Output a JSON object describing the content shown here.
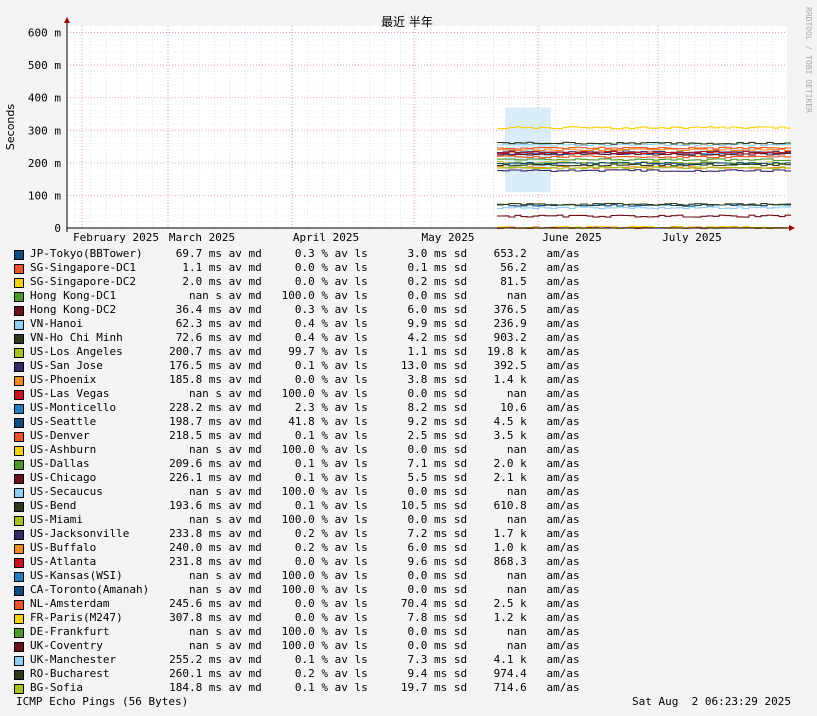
{
  "chart_data": {
    "type": "line",
    "title": "最近 半年",
    "ylabel": "Seconds",
    "vertical_label": "RRDTOOL / TOBI OETIKER",
    "ylim": [
      0,
      0.62
    ],
    "y_ticks": [
      "0",
      "100 m",
      "200 m",
      "300 m",
      "400 m",
      "500 m",
      "600 m"
    ],
    "x_ticks": [
      "February 2025",
      "March 2025",
      "April 2025",
      "May 2025",
      "June 2025",
      "July 2025"
    ],
    "grid": true,
    "data_start_label": "May 2025",
    "series": [
      {
        "name": "JP-Tokyo(BBTower)",
        "color": "#0b4d7d",
        "value": "69.7 ms av md",
        "loss": "0.3 % av ls",
        "sd": "3.0 ms sd",
        "ratio": "653.2",
        "unit": "am/as"
      },
      {
        "name": "SG-Singapore-DC1",
        "color": "#ee5522",
        "value": "1.1 ms av md",
        "loss": "0.0 % av ls",
        "sd": "0.1 ms sd",
        "ratio": "56.2",
        "unit": "am/as"
      },
      {
        "name": "SG-Singapore-DC2",
        "color": "#f7d200",
        "value": "2.0 ms av md",
        "loss": "0.0 % av ls",
        "sd": "0.2 ms sd",
        "ratio": "81.5",
        "unit": "am/as"
      },
      {
        "name": "Hong Kong-DC1",
        "color": "#4c9a2a",
        "value": "nan s av md",
        "loss": "100.0 % av ls",
        "sd": "0.0 ms sd",
        "ratio": "nan",
        "unit": "am/as"
      },
      {
        "name": "Hong Kong-DC2",
        "color": "#6b0f1a",
        "value": "36.4 ms av md",
        "loss": "0.3 % av ls",
        "sd": "6.0 ms sd",
        "ratio": "376.5",
        "unit": "am/as"
      },
      {
        "name": "VN-Hanoi",
        "color": "#8ecdf5",
        "value": "62.3 ms av md",
        "loss": "0.4 % av ls",
        "sd": "9.9 ms sd",
        "ratio": "236.9",
        "unit": "am/as"
      },
      {
        "name": "VN-Ho Chi Minh",
        "color": "#2d3b16",
        "value": "72.6 ms av md",
        "loss": "0.4 % av ls",
        "sd": "4.2 ms sd",
        "ratio": "903.2",
        "unit": "am/as"
      },
      {
        "name": "US-Los Angeles",
        "color": "#a6c21c",
        "value": "200.7 ms av md",
        "loss": "99.7 % av ls",
        "sd": "1.1 ms sd",
        "ratio": "19.8 k",
        "unit": "am/as"
      },
      {
        "name": "US-San Jose",
        "color": "#3b2a6b",
        "value": "176.5 ms av md",
        "loss": "0.1 % av ls",
        "sd": "13.0 ms sd",
        "ratio": "392.5",
        "unit": "am/as"
      },
      {
        "name": "US-Phoenix",
        "color": "#f08a1c",
        "value": "185.8 ms av md",
        "loss": "0.0 % av ls",
        "sd": "3.8 ms sd",
        "ratio": "1.4 k",
        "unit": "am/as"
      },
      {
        "name": "US-Las Vegas",
        "color": "#c8101e",
        "value": "nan s av md",
        "loss": "100.0 % av ls",
        "sd": "0.0 ms sd",
        "ratio": "nan",
        "unit": "am/as"
      },
      {
        "name": "US-Monticello",
        "color": "#1e7fc0",
        "value": "228.2 ms av md",
        "loss": "2.3 % av ls",
        "sd": "8.2 ms sd",
        "ratio": "10.6",
        "unit": "am/as"
      },
      {
        "name": "US-Seattle",
        "color": "#0b4d7d",
        "value": "198.7 ms av md",
        "loss": "41.8 % av ls",
        "sd": "9.2 ms sd",
        "ratio": "4.5 k",
        "unit": "am/as"
      },
      {
        "name": "US-Denver",
        "color": "#ee5522",
        "value": "218.5 ms av md",
        "loss": "0.1 % av ls",
        "sd": "2.5 ms sd",
        "ratio": "3.5 k",
        "unit": "am/as"
      },
      {
        "name": "US-Ashburn",
        "color": "#f7d200",
        "value": "nan s av md",
        "loss": "100.0 % av ls",
        "sd": "0.0 ms sd",
        "ratio": "nan",
        "unit": "am/as"
      },
      {
        "name": "US-Dallas",
        "color": "#4c9a2a",
        "value": "209.6 ms av md",
        "loss": "0.1 % av ls",
        "sd": "7.1 ms sd",
        "ratio": "2.0 k",
        "unit": "am/as"
      },
      {
        "name": "US-Chicago",
        "color": "#6b0f1a",
        "value": "226.1 ms av md",
        "loss": "0.1 % av ls",
        "sd": "5.5 ms sd",
        "ratio": "2.1 k",
        "unit": "am/as"
      },
      {
        "name": "US-Secaucus",
        "color": "#8ecdf5",
        "value": "nan s av md",
        "loss": "100.0 % av ls",
        "sd": "0.0 ms sd",
        "ratio": "nan",
        "unit": "am/as"
      },
      {
        "name": "US-Bend",
        "color": "#2d3b16",
        "value": "193.6 ms av md",
        "loss": "0.1 % av ls",
        "sd": "10.5 ms sd",
        "ratio": "610.8",
        "unit": "am/as"
      },
      {
        "name": "US-Miami",
        "color": "#a6c21c",
        "value": "nan s av md",
        "loss": "100.0 % av ls",
        "sd": "0.0 ms sd",
        "ratio": "nan",
        "unit": "am/as"
      },
      {
        "name": "US-Jacksonville",
        "color": "#3b2a6b",
        "value": "233.8 ms av md",
        "loss": "0.2 % av ls",
        "sd": "7.2 ms sd",
        "ratio": "1.7 k",
        "unit": "am/as"
      },
      {
        "name": "US-Buffalo",
        "color": "#f08a1c",
        "value": "240.0 ms av md",
        "loss": "0.2 % av ls",
        "sd": "6.0 ms sd",
        "ratio": "1.0 k",
        "unit": "am/as"
      },
      {
        "name": "US-Atlanta",
        "color": "#c8101e",
        "value": "231.8 ms av md",
        "loss": "0.0 % av ls",
        "sd": "9.6 ms sd",
        "ratio": "868.3",
        "unit": "am/as"
      },
      {
        "name": "US-Kansas(WSI)",
        "color": "#1e7fc0",
        "value": "nan s av md",
        "loss": "100.0 % av ls",
        "sd": "0.0 ms sd",
        "ratio": "nan",
        "unit": "am/as"
      },
      {
        "name": "CA-Toronto(Amanah)",
        "color": "#0b4d7d",
        "value": "nan s av md",
        "loss": "100.0 % av ls",
        "sd": "0.0 ms sd",
        "ratio": "nan",
        "unit": "am/as"
      },
      {
        "name": "NL-Amsterdam",
        "color": "#ee5522",
        "value": "245.6 ms av md",
        "loss": "0.0 % av ls",
        "sd": "70.4 ms sd",
        "ratio": "2.5 k",
        "unit": "am/as"
      },
      {
        "name": "FR-Paris(M247)",
        "color": "#f7d200",
        "value": "307.8 ms av md",
        "loss": "0.0 % av ls",
        "sd": "7.8 ms sd",
        "ratio": "1.2 k",
        "unit": "am/as"
      },
      {
        "name": "DE-Frankfurt",
        "color": "#4c9a2a",
        "value": "nan s av md",
        "loss": "100.0 % av ls",
        "sd": "0.0 ms sd",
        "ratio": "nan",
        "unit": "am/as"
      },
      {
        "name": "UK-Coventry",
        "color": "#6b0f1a",
        "value": "nan s av md",
        "loss": "100.0 % av ls",
        "sd": "0.0 ms sd",
        "ratio": "nan",
        "unit": "am/as"
      },
      {
        "name": "UK-Manchester",
        "color": "#8ecdf5",
        "value": "255.2 ms av md",
        "loss": "0.1 % av ls",
        "sd": "7.3 ms sd",
        "ratio": "4.1 k",
        "unit": "am/as"
      },
      {
        "name": "RO-Bucharest",
        "color": "#2d3b16",
        "value": "260.1 ms av md",
        "loss": "0.2 % av ls",
        "sd": "9.4 ms sd",
        "ratio": "974.4",
        "unit": "am/as"
      },
      {
        "name": "BG-Sofia",
        "color": "#a6c21c",
        "value": "184.8 ms av md",
        "loss": "0.1 % av ls",
        "sd": "19.7 ms sd",
        "ratio": "714.6",
        "unit": "am/as"
      }
    ]
  },
  "footer": {
    "left": "ICMP Echo Pings (56 Bytes)",
    "right": "Sat Aug  2 06:23:29 2025"
  }
}
